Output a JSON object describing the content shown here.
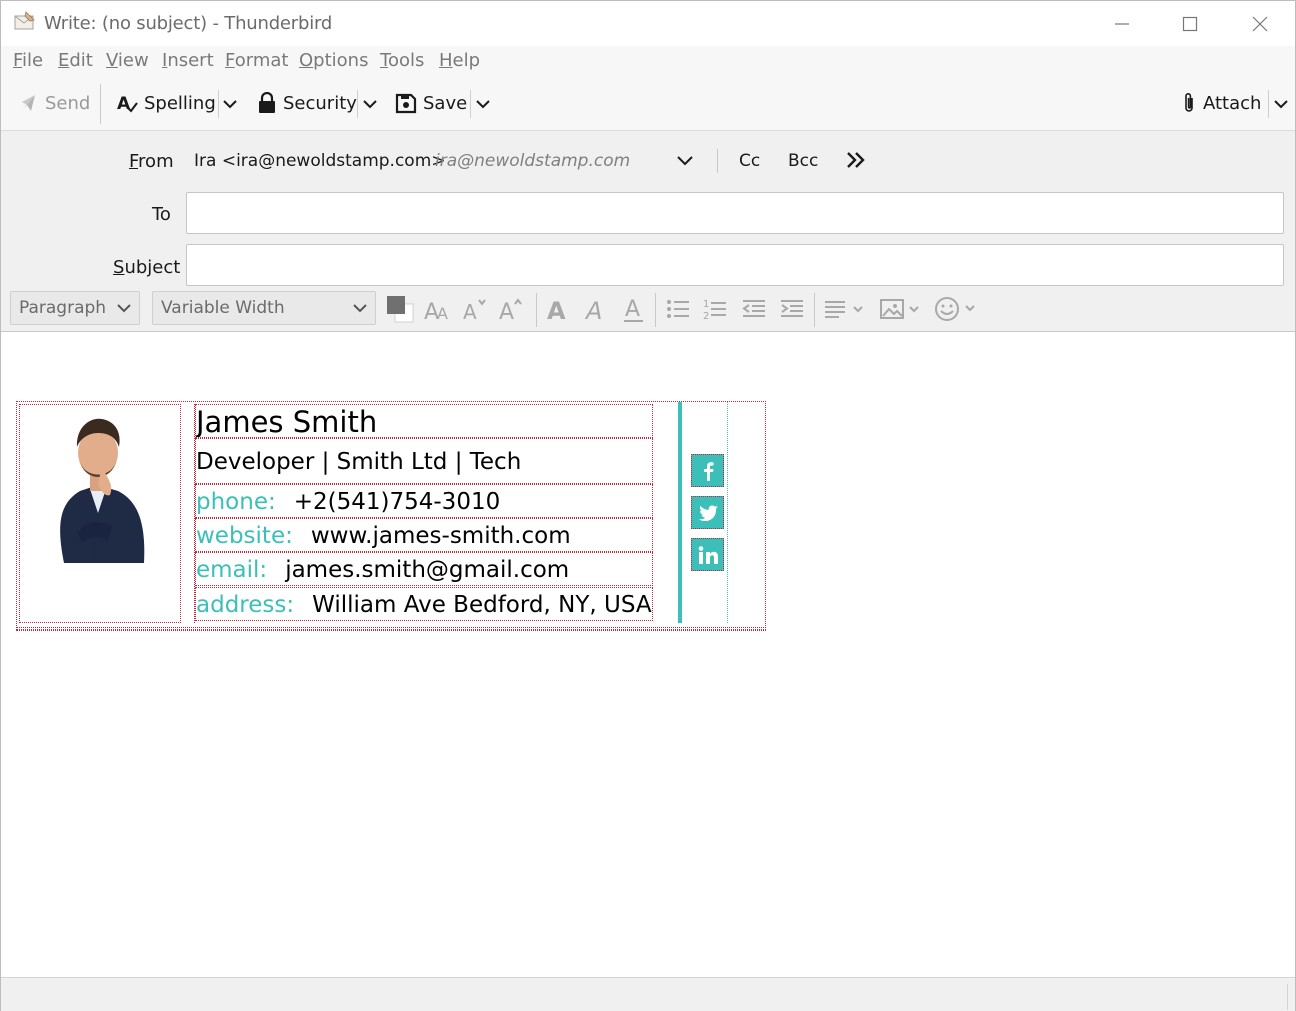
{
  "window": {
    "title": "Write: (no subject) - Thunderbird"
  },
  "menubar": {
    "items": [
      "File",
      "Edit",
      "View",
      "Insert",
      "Format",
      "Options",
      "Tools",
      "Help"
    ]
  },
  "toolbar": {
    "send_label": "Send",
    "spelling_label": "Spelling",
    "security_label": "Security",
    "save_label": "Save",
    "attach_label": "Attach"
  },
  "header": {
    "from_label": "From",
    "from_value": "Ira <ira@newoldstamp.com>",
    "from_identity": "ira@newoldstamp.com",
    "cc_label": "Cc",
    "bcc_label": "Bcc",
    "to_label": "To",
    "to_value": "",
    "subject_label": "Subject",
    "subject_value": ""
  },
  "format_toolbar": {
    "paragraph_value": "Paragraph",
    "font_value": "Variable Width"
  },
  "signature": {
    "name": "James Smith",
    "role": "Developer | Smith Ltd | Tech",
    "phone_key": "phone:",
    "phone_value": "+2(541)754-3010",
    "website_key": "website:",
    "website_value": "www.james-smith.com",
    "email_key": "email:",
    "email_value": "james.smith@gmail.com",
    "address_key": "address:",
    "address_value": "William Ave Bedford, NY, USA",
    "accent_color": "#3bbfb8",
    "social": [
      "facebook-icon",
      "twitter-icon",
      "linkedin-icon"
    ]
  }
}
